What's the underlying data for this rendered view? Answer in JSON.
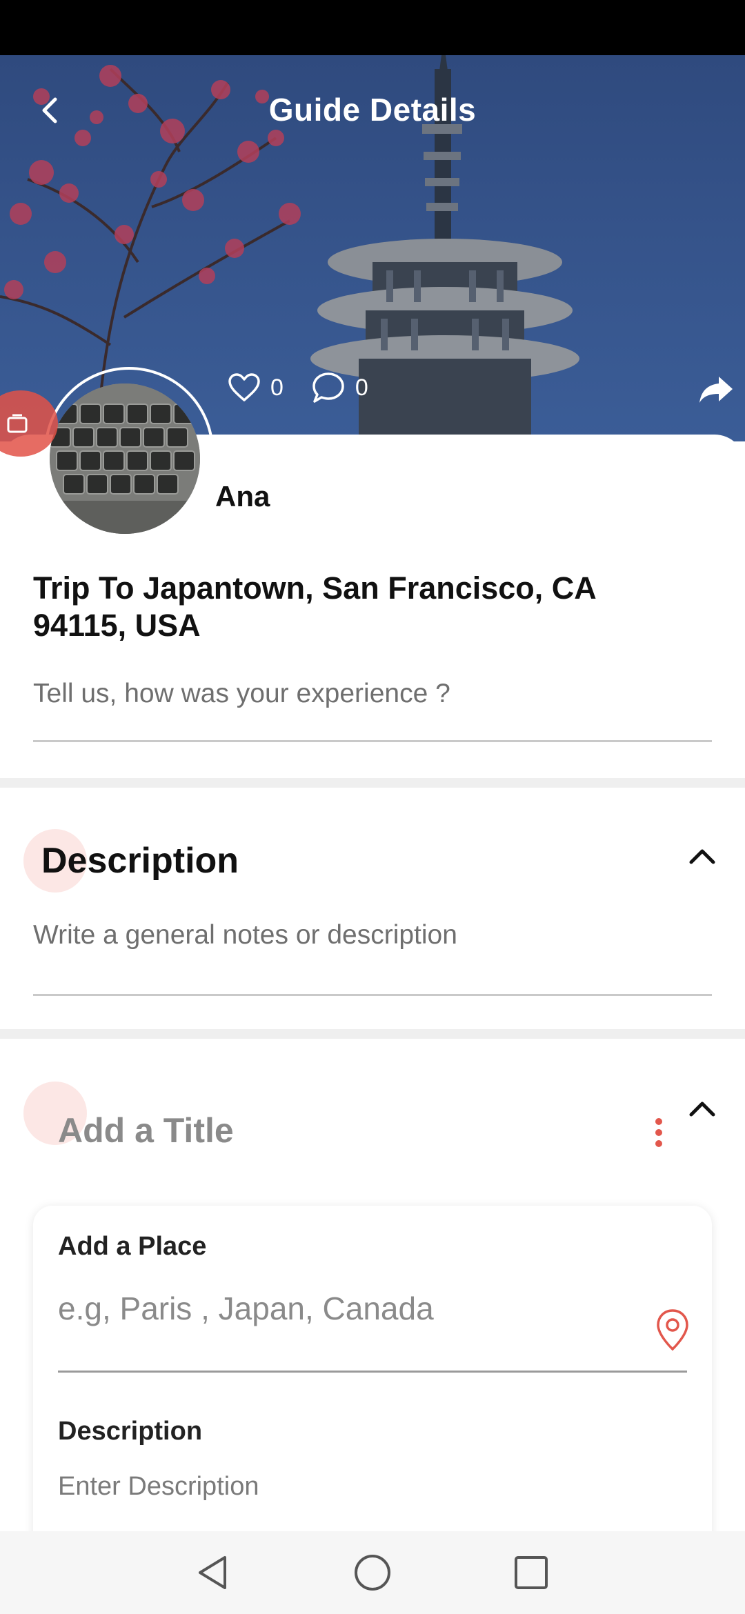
{
  "header": {
    "title": "Guide Details",
    "likes_count": "0",
    "comments_count": "0"
  },
  "user": {
    "name": "Ana"
  },
  "trip": {
    "title": "Trip To Japantown, San Francisco, CA 94115, USA",
    "experience_placeholder": "Tell us, how was your experience ?"
  },
  "description_section": {
    "title": "Description",
    "placeholder": "Write a general notes or description"
  },
  "entry": {
    "title_placeholder": "Add a Title",
    "place_label": "Add a Place",
    "place_placeholder": "e.g, Paris , Japan, Canada",
    "description_label": "Description",
    "description_placeholder": "Enter Description"
  },
  "colors": {
    "accent": "#e2574c",
    "text_primary": "#111111",
    "placeholder": "#6f6f6f",
    "separator": "#efefef"
  },
  "icons": {
    "back": "chevron-left-icon",
    "like": "heart-icon",
    "comment": "comment-bubble-icon",
    "share": "share-arrow-icon",
    "collapse": "chevron-up-icon",
    "more": "vertical-dots-icon",
    "location": "map-pin-icon"
  }
}
